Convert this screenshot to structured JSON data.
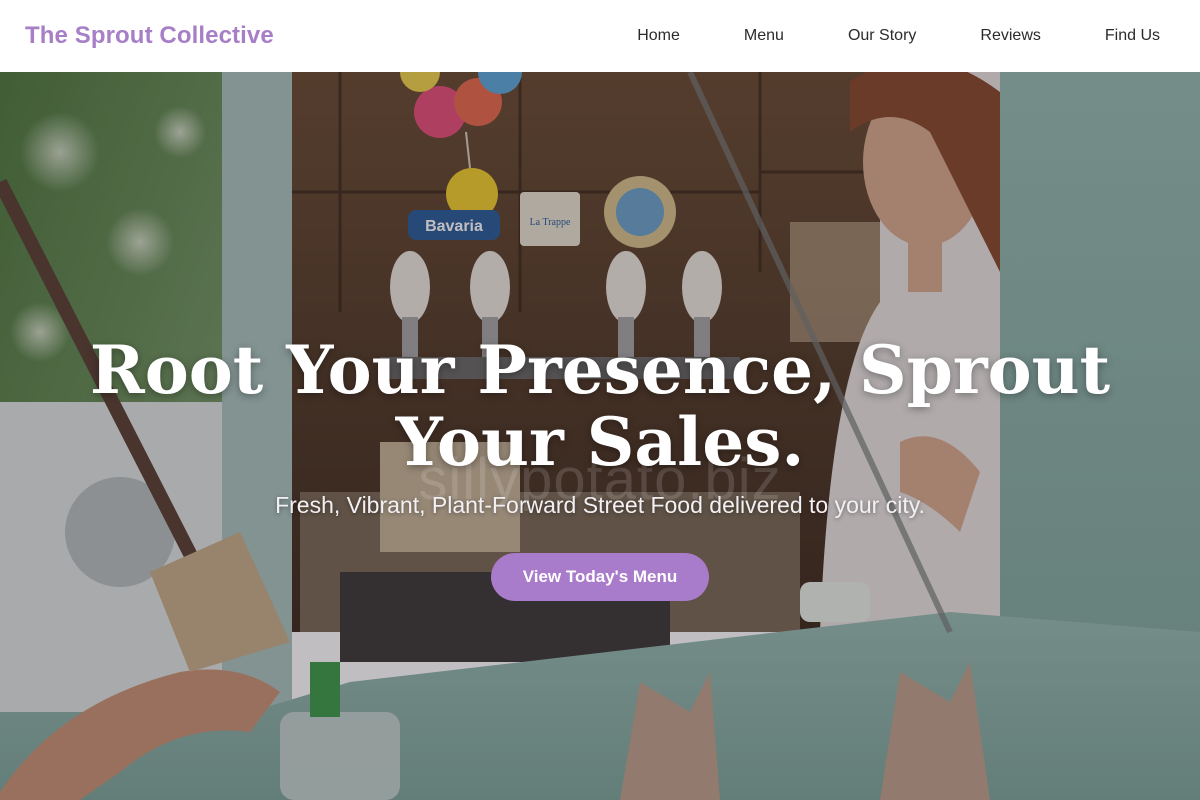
{
  "header": {
    "brand": "The Sprout Collective",
    "nav": [
      {
        "label": "Home"
      },
      {
        "label": "Menu"
      },
      {
        "label": "Our Story"
      },
      {
        "label": "Reviews"
      },
      {
        "label": "Find Us"
      }
    ]
  },
  "hero": {
    "title": "Root Your Presence, Sprout Your Sales.",
    "subtitle": "Fresh, Vibrant, Plant-Forward Street Food delivered to your city.",
    "cta_label": "View Today's Menu",
    "watermark": "sillypotato.biz",
    "photo_signs": {
      "left_tap_sign": "Bavaria",
      "middle_tap_sign": "La Trappe"
    }
  },
  "colors": {
    "brand": "#a77fc7",
    "cta_background": "#a97bcb",
    "nav_text": "#2b2b2b",
    "truck_teal": "#8fb3a9"
  }
}
